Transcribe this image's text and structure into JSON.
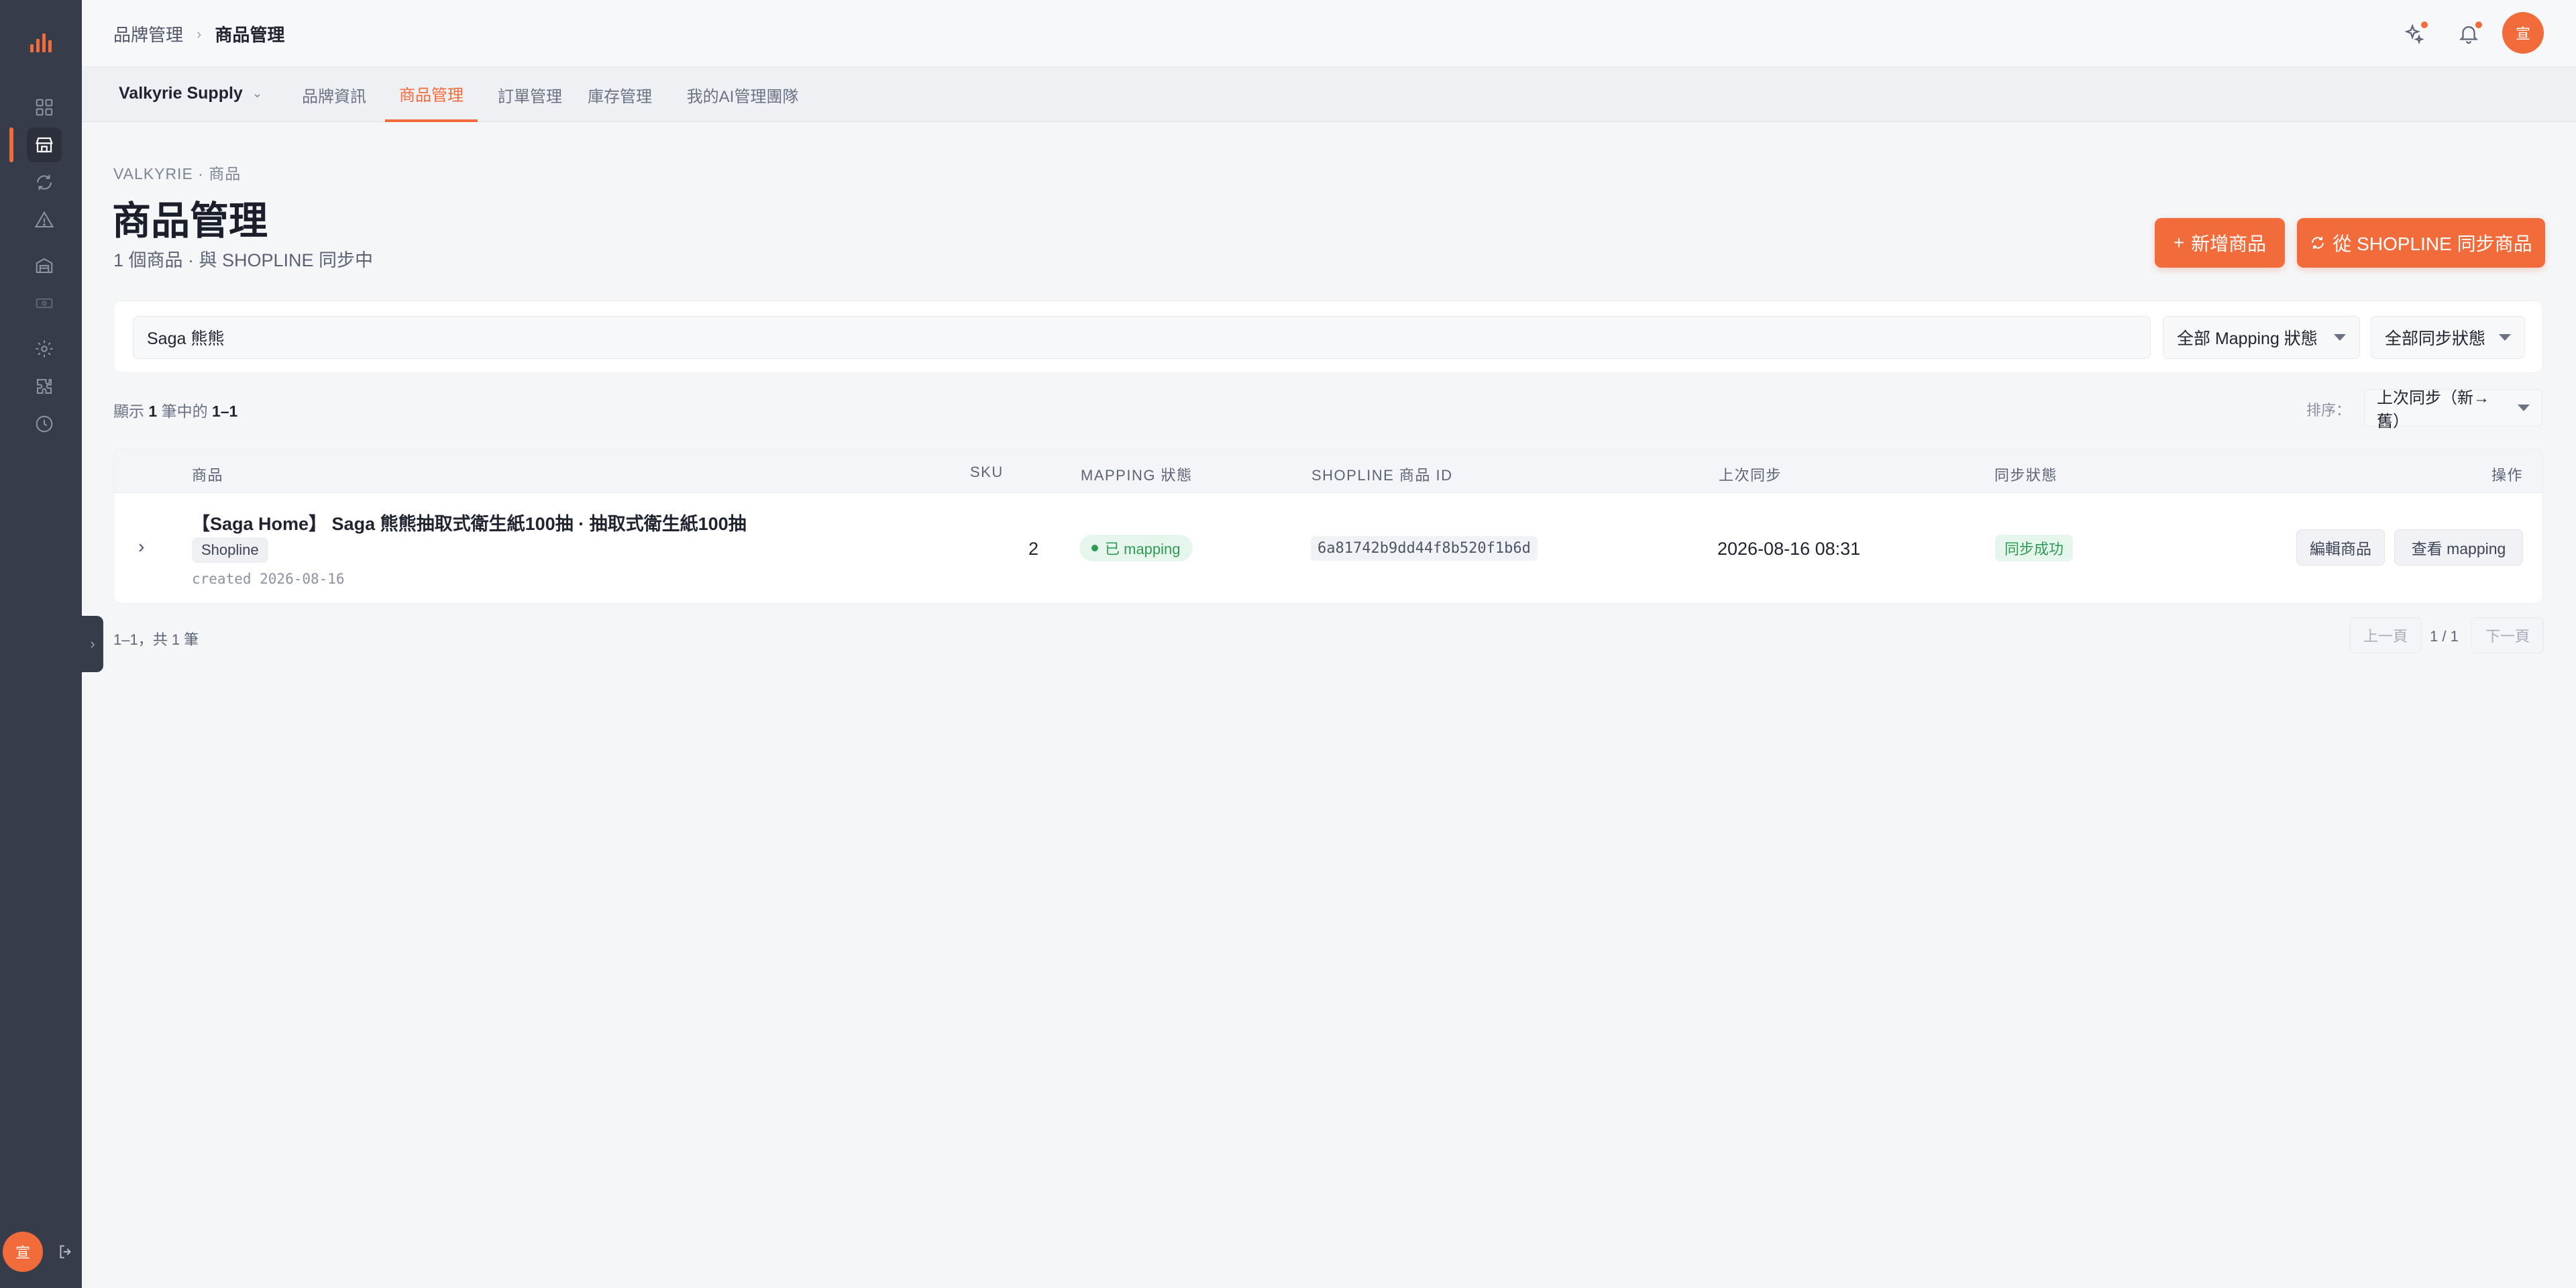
{
  "app": {
    "brand_color": "#f26b3a"
  },
  "rail": {
    "items": [
      {
        "name": "dashboard-icon"
      },
      {
        "name": "store-icon",
        "active": true
      },
      {
        "name": "sync-icon"
      },
      {
        "name": "warning-icon"
      },
      {
        "name": "warehouse-icon"
      },
      {
        "name": "cash-icon"
      },
      {
        "name": "gear-icon"
      },
      {
        "name": "puzzle-icon"
      },
      {
        "name": "clock-icon"
      }
    ],
    "user_initial": "宣"
  },
  "header": {
    "breadcrumb": {
      "parent": "品牌管理",
      "current": "商品管理"
    },
    "user_initial": "宣"
  },
  "subnav": {
    "brand": "Valkyrie Supply",
    "tabs": [
      {
        "label": "品牌資訊"
      },
      {
        "label": "商品管理",
        "active": true
      },
      {
        "label": "訂單管理"
      },
      {
        "label": "庫存管理"
      },
      {
        "label": "我的AI管理團隊"
      }
    ]
  },
  "page": {
    "kicker": "VALKYRIE · 商品",
    "title": "商品管理",
    "subtitle": "1 個商品 · 與 SHOPLINE 同步中",
    "add_button": "新增商品",
    "sync_button": "從 SHOPLINE 同步商品"
  },
  "filters": {
    "search_value": "Saga 熊熊",
    "mapping_select": "全部 Mapping 狀態",
    "sync_select": "全部同步狀態"
  },
  "summary": {
    "prefix": "顯示",
    "total": "1",
    "middle": "筆中的",
    "range": "1–1",
    "sort_label": "排序：",
    "sort_value": "上次同步（新→舊）"
  },
  "table": {
    "headers": {
      "product": "商品",
      "sku": "SKU",
      "mapping": "MAPPING 狀態",
      "shopline_id": "SHOPLINE 商品 ID",
      "last_sync": "上次同步",
      "sync_status": "同步狀態",
      "actions": "操作"
    },
    "rows": [
      {
        "title": "【Saga Home】 Saga 熊熊抽取式衛生紙100抽 · 抽取式衛生紙100抽",
        "source_chip": "Shopline",
        "created": "created 2026-08-16",
        "sku": "2",
        "mapping": "已 mapping",
        "shopline_id": "6a81742b9dd44f8b520f1b6d",
        "last_sync": "2026-08-16 08:31",
        "sync_status": "同步成功",
        "edit_label": "編輯商品",
        "view_mapping_label": "查看 mapping"
      }
    ]
  },
  "pagination": {
    "info": "1–1，共 1 筆",
    "prev": "上一頁",
    "page": "1 / 1",
    "next": "下一頁"
  }
}
